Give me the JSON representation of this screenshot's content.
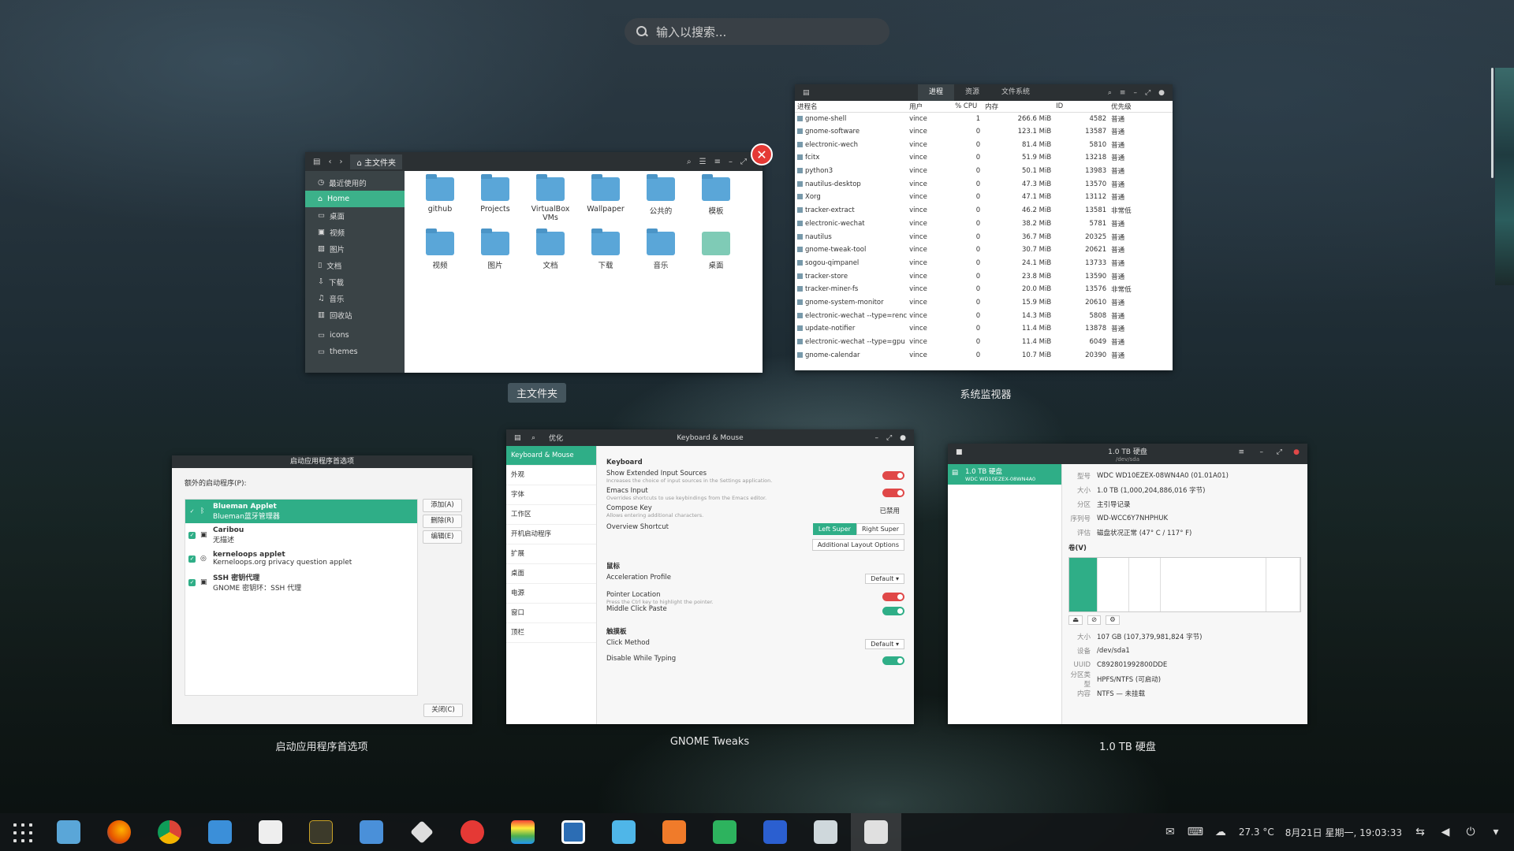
{
  "search": {
    "placeholder": "输入以搜索..."
  },
  "windows": {
    "files": {
      "caption": "主文件夹",
      "path": "主文件夹",
      "sidebar": [
        "最近使用的",
        "Home",
        "桌面",
        "视频",
        "图片",
        "文档",
        "下载",
        "音乐",
        "回收站",
        "icons",
        "themes"
      ],
      "folders": [
        "github",
        "Projects",
        "VirtualBox VMs",
        "Wallpaper",
        "公共的",
        "模板",
        "视频",
        "图片",
        "文档",
        "下载",
        "音乐",
        "桌面"
      ]
    },
    "monitor": {
      "caption": "系统监视器",
      "tabs": [
        "进程",
        "资源",
        "文件系统"
      ],
      "columns": [
        "进程名",
        "用户",
        "% CPU",
        "内存",
        "ID",
        "优先级"
      ],
      "rows": [
        [
          "gnome-shell",
          "vince",
          "1",
          "266.6 MiB",
          "4582",
          "普通"
        ],
        [
          "gnome-software",
          "vince",
          "0",
          "123.1 MiB",
          "13587",
          "普通"
        ],
        [
          "electronic-wech",
          "vince",
          "0",
          "81.4 MiB",
          "5810",
          "普通"
        ],
        [
          "fcitx",
          "vince",
          "0",
          "51.9 MiB",
          "13218",
          "普通"
        ],
        [
          "python3",
          "vince",
          "0",
          "50.1 MiB",
          "13983",
          "普通"
        ],
        [
          "nautilus-desktop",
          "vince",
          "0",
          "47.3 MiB",
          "13570",
          "普通"
        ],
        [
          "Xorg",
          "vince",
          "0",
          "47.1 MiB",
          "13112",
          "普通"
        ],
        [
          "tracker-extract",
          "vince",
          "0",
          "46.2 MiB",
          "13581",
          "非常低"
        ],
        [
          "electronic-wechat",
          "vince",
          "0",
          "38.2 MiB",
          "5781",
          "普通"
        ],
        [
          "nautilus",
          "vince",
          "0",
          "36.7 MiB",
          "20325",
          "普通"
        ],
        [
          "gnome-tweak-tool",
          "vince",
          "0",
          "30.7 MiB",
          "20621",
          "普通"
        ],
        [
          "sogou-qimpanel",
          "vince",
          "0",
          "24.1 MiB",
          "13733",
          "普通"
        ],
        [
          "tracker-store",
          "vince",
          "0",
          "23.8 MiB",
          "13590",
          "普通"
        ],
        [
          "tracker-miner-fs",
          "vince",
          "0",
          "20.0 MiB",
          "13576",
          "非常低"
        ],
        [
          "gnome-system-monitor",
          "vince",
          "0",
          "15.9 MiB",
          "20610",
          "普通"
        ],
        [
          "electronic-wechat --type=renc",
          "vince",
          "0",
          "14.3 MiB",
          "5808",
          "普通"
        ],
        [
          "update-notifier",
          "vince",
          "0",
          "11.4 MiB",
          "13878",
          "普通"
        ],
        [
          "electronic-wechat --type=gpu",
          "vince",
          "0",
          "11.4 MiB",
          "6049",
          "普通"
        ],
        [
          "gnome-calendar",
          "vince",
          "0",
          "10.7 MiB",
          "20390",
          "普通"
        ]
      ]
    },
    "startup": {
      "caption": "启动应用程序首选项",
      "title": "启动应用程序首选项",
      "label": "额外的启动程序(P):",
      "items": [
        {
          "name": "Blueman Applet",
          "desc": "Blueman蓝牙管理器"
        },
        {
          "name": "Caribou",
          "desc": "无描述"
        },
        {
          "name": "kerneloops applet",
          "desc": "Kerneloops.org privacy question applet"
        },
        {
          "name": "SSH 密钥代理",
          "desc": "GNOME 密钥环：SSH 代理"
        }
      ],
      "buttons": [
        "添加(A)",
        "删除(R)",
        "编辑(E)"
      ],
      "close": "关闭(C)"
    },
    "tweaks": {
      "caption": "GNOME Tweaks",
      "app": "优化",
      "title": "Keyboard & Mouse",
      "sidebar": [
        "Keyboard & Mouse",
        "外观",
        "字体",
        "工作区",
        "开机启动程序",
        "扩展",
        "桌面",
        "电源",
        "窗口",
        "顶栏"
      ],
      "keyboard_h": "Keyboard",
      "ext_input": "Show Extended Input Sources",
      "ext_input_sub": "Increases the choice of input sources in the Settings application.",
      "emacs": "Emacs Input",
      "emacs_sub": "Overrides shortcuts to use keybindings from the Emacs editor.",
      "compose": "Compose Key",
      "compose_sub": "Allows entering additional characters.",
      "compose_val": "已禁用",
      "overview": "Overview Shortcut",
      "left_super": "Left Super",
      "right_super": "Right Super",
      "layout_opts": "Additional Layout Options",
      "mouse_h": "鼠标",
      "accel": "Acceleration Profile",
      "accel_val": "Default",
      "pointer": "Pointer Location",
      "pointer_sub": "Press the Ctrl key to highlight the pointer.",
      "middle": "Middle Click Paste",
      "touch_h": "触摸板",
      "click": "Click Method",
      "click_val": "Default",
      "disable_typing": "Disable While Typing"
    },
    "disks": {
      "caption": "1.0 TB 硬盘",
      "title": "1.0 TB 硬盘",
      "subtitle": "/dev/sda",
      "side_name": "1.0 TB 硬盘",
      "side_model": "WDC WD10EZEX-08WN4A0",
      "model_k": "型号",
      "model_v": "WDC WD10EZEX-08WN4A0 (01.01A01)",
      "size_k": "大小",
      "size_v": "1.0 TB (1,000,204,886,016 字节)",
      "part_k": "分区",
      "part_v": "主引导记录",
      "serial_k": "序列号",
      "serial_v": "WD-WCC6Y7NHPHUK",
      "eval_k": "评估",
      "eval_v": "磁盘状况正常 (47° C / 117° F)",
      "volumes_h": "卷(V)",
      "vsize_k": "大小",
      "vsize_v": "107 GB (107,379,981,824 字节)",
      "dev_k": "设备",
      "dev_v": "/dev/sda1",
      "uuid_k": "UUID",
      "uuid_v": "C892801992800DDE",
      "type_k": "分区类型",
      "type_v": "HPFS/NTFS (可启动)",
      "content_k": "内容",
      "content_v": "NTFS — 未挂载"
    }
  },
  "tray": {
    "temp": "27.3 °C",
    "datetime": "8月21日 星期一, 19:03:33"
  },
  "taskbar_apps": [
    "files",
    "firefox",
    "chrome",
    "toggle",
    "store",
    "monitor",
    "mail",
    "inkscape",
    "netease",
    "colors",
    "virtualbox",
    "wps-writer-blue",
    "wps-presentation",
    "wps-sheet",
    "wps-writer",
    "screenshot",
    "disks"
  ]
}
